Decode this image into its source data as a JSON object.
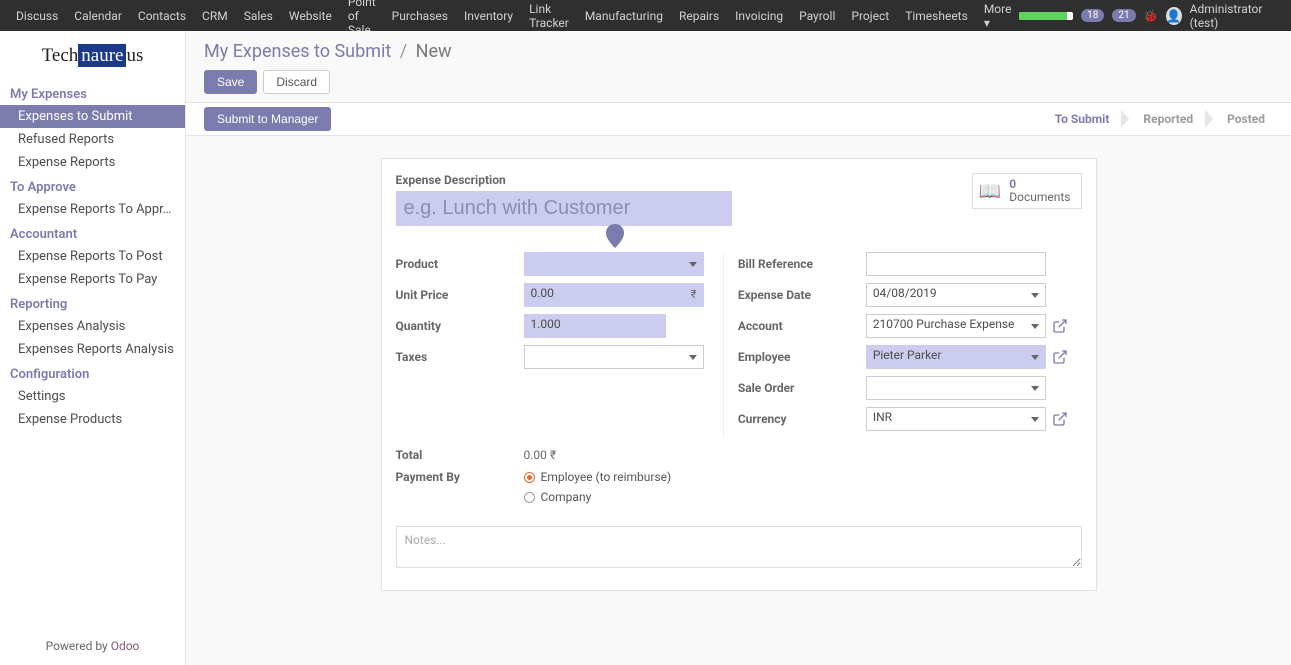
{
  "topnav": {
    "items": [
      "Discuss",
      "Calendar",
      "Contacts",
      "CRM",
      "Sales",
      "Website",
      "Point of Sale",
      "Purchases",
      "Inventory",
      "Link Tracker",
      "Manufacturing",
      "Repairs",
      "Invoicing",
      "Payroll",
      "Project",
      "Timesheets",
      "More ▾"
    ],
    "msg_count": "18",
    "chat_count": "21",
    "user_label": "Administrator (test)"
  },
  "logo": {
    "prefix": "Tech",
    "mid": "naure",
    "suffix": "us"
  },
  "sidebar": {
    "s0": {
      "head": "My Expenses",
      "items": [
        "Expenses to Submit",
        "Refused Reports",
        "Expense Reports"
      ]
    },
    "s1": {
      "head": "To Approve",
      "items": [
        "Expense Reports To Appr…"
      ]
    },
    "s2": {
      "head": "Accountant",
      "items": [
        "Expense Reports To Post",
        "Expense Reports To Pay"
      ]
    },
    "s3": {
      "head": "Reporting",
      "items": [
        "Expenses Analysis",
        "Expenses Reports Analysis"
      ]
    },
    "s4": {
      "head": "Configuration",
      "items": [
        "Settings",
        "Expense Products"
      ]
    }
  },
  "footer": {
    "prefix": "Powered by ",
    "brand": "Odoo"
  },
  "breadcrumb": {
    "root": "My Expenses to Submit",
    "current": "New"
  },
  "buttons": {
    "save": "Save",
    "discard": "Discard",
    "submit": "Submit to Manager"
  },
  "status": {
    "s0": "To Submit",
    "s1": "Reported",
    "s2": "Posted"
  },
  "docs": {
    "count": "0",
    "label": "Documents"
  },
  "form": {
    "desc_label": "Expense Description",
    "desc_placeholder": "e.g. Lunch with Customer",
    "left": {
      "product": {
        "label": "Product",
        "value": ""
      },
      "unit_price": {
        "label": "Unit Price",
        "value": "0.00"
      },
      "quantity": {
        "label": "Quantity",
        "value": "1.000"
      },
      "taxes": {
        "label": "Taxes",
        "value": ""
      }
    },
    "right": {
      "bill_ref": {
        "label": "Bill Reference",
        "value": ""
      },
      "exp_date": {
        "label": "Expense Date",
        "value": "04/08/2019"
      },
      "account": {
        "label": "Account",
        "value": "210700 Purchase Expense"
      },
      "employee": {
        "label": "Employee",
        "value": "Pieter Parker"
      },
      "sale_order": {
        "label": "Sale Order",
        "value": ""
      },
      "currency": {
        "label": "Currency",
        "value": "INR"
      }
    },
    "total": {
      "label": "Total",
      "value": "0.00 ₹"
    },
    "payment": {
      "label": "Payment By",
      "opt1": "Employee (to reimburse)",
      "opt2": "Company"
    },
    "notes_placeholder": "Notes..."
  }
}
